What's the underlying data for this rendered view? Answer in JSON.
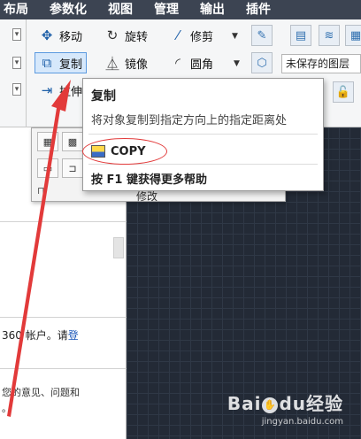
{
  "menubar": {
    "items": [
      "布局",
      "参数化",
      "视图",
      "管理",
      "输出",
      "插件"
    ]
  },
  "ribbon": {
    "tools": {
      "move": "移动",
      "rotate": "旋转",
      "trim": "修剪",
      "copy": "复制",
      "mirror": "镜像",
      "fillet": "圆角",
      "stretch": "拉伸"
    },
    "property_box": "未保存的图层",
    "modify_panel_label": "修改"
  },
  "tooltip": {
    "title": "复制",
    "description": "将对象复制到指定方向上的指定距离处",
    "command": "COPY",
    "help": "按 F1 键获得更多帮助"
  },
  "leftpanel": {
    "account_text": "360 帐户。请",
    "account_link": "登",
    "feedback_text": "您的意见、问题和",
    "feedback_tail": "。"
  },
  "watermark": {
    "logo_left": "Bai",
    "logo_mid": "du",
    "logo_right": "经验",
    "sub": "jingyan.baidu.com"
  },
  "colors": {
    "menubar": "#3c4452",
    "canvas": "#232a36",
    "highlight": "#d6e8fb",
    "annotation": "#e23a3a"
  }
}
